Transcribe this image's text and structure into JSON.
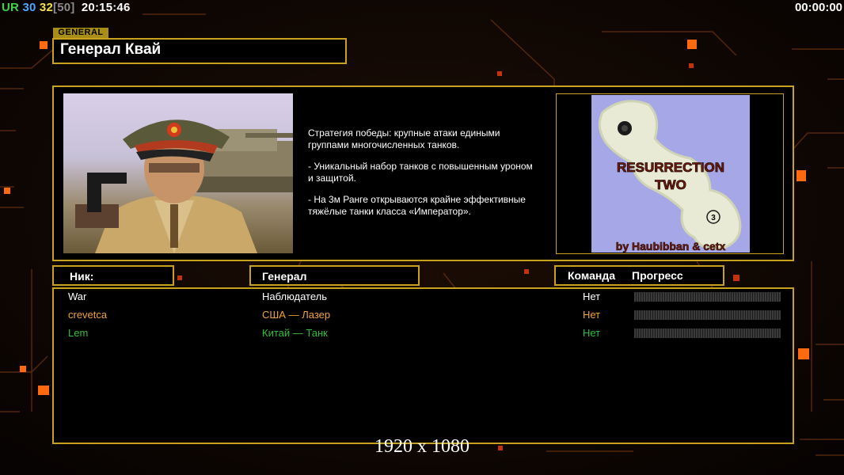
{
  "hud": {
    "ur": "UR",
    "num1": "30",
    "num2": "32",
    "bracket_value": "[50]",
    "clock": "20:15:46",
    "timer": "00:00:00"
  },
  "general": {
    "tag": "GENERAL",
    "name": "Генерал Квай"
  },
  "description": [
    "Стратегия победы: крупные атаки едиными\n группами многочисленных танков.",
    "- Уникальный набор танков с повышенным уроном\n и защитой.",
    "- На 3м Ранге открываются крайне эффективные\n тяжёлые танки класса «Император»."
  ],
  "map": {
    "title_line1": "RESURRECTION",
    "title_line2": "TWO",
    "credit": "by Haubibban & cetx",
    "marker": "3"
  },
  "headers": {
    "nick": "Ник:",
    "general": "Генерал",
    "team": "Команда",
    "progress": "Прогресс"
  },
  "players": [
    {
      "name": "War",
      "general": "Наблюдатель",
      "team": "Нет",
      "color": "#ffffff",
      "progress": 0
    },
    {
      "name": "crevetca",
      "general": "США — Лазер",
      "team": "Нет",
      "color": "#f2a23a",
      "progress": 0
    },
    {
      "name": "Lem",
      "general": "Китай — Танк",
      "team": "Нет",
      "color": "#2fbf3a",
      "progress": 0
    }
  ],
  "resolution": "1920 x 1080",
  "colors": {
    "accent_border": "#c8a21c",
    "accent_orange": "#ff6a10"
  }
}
